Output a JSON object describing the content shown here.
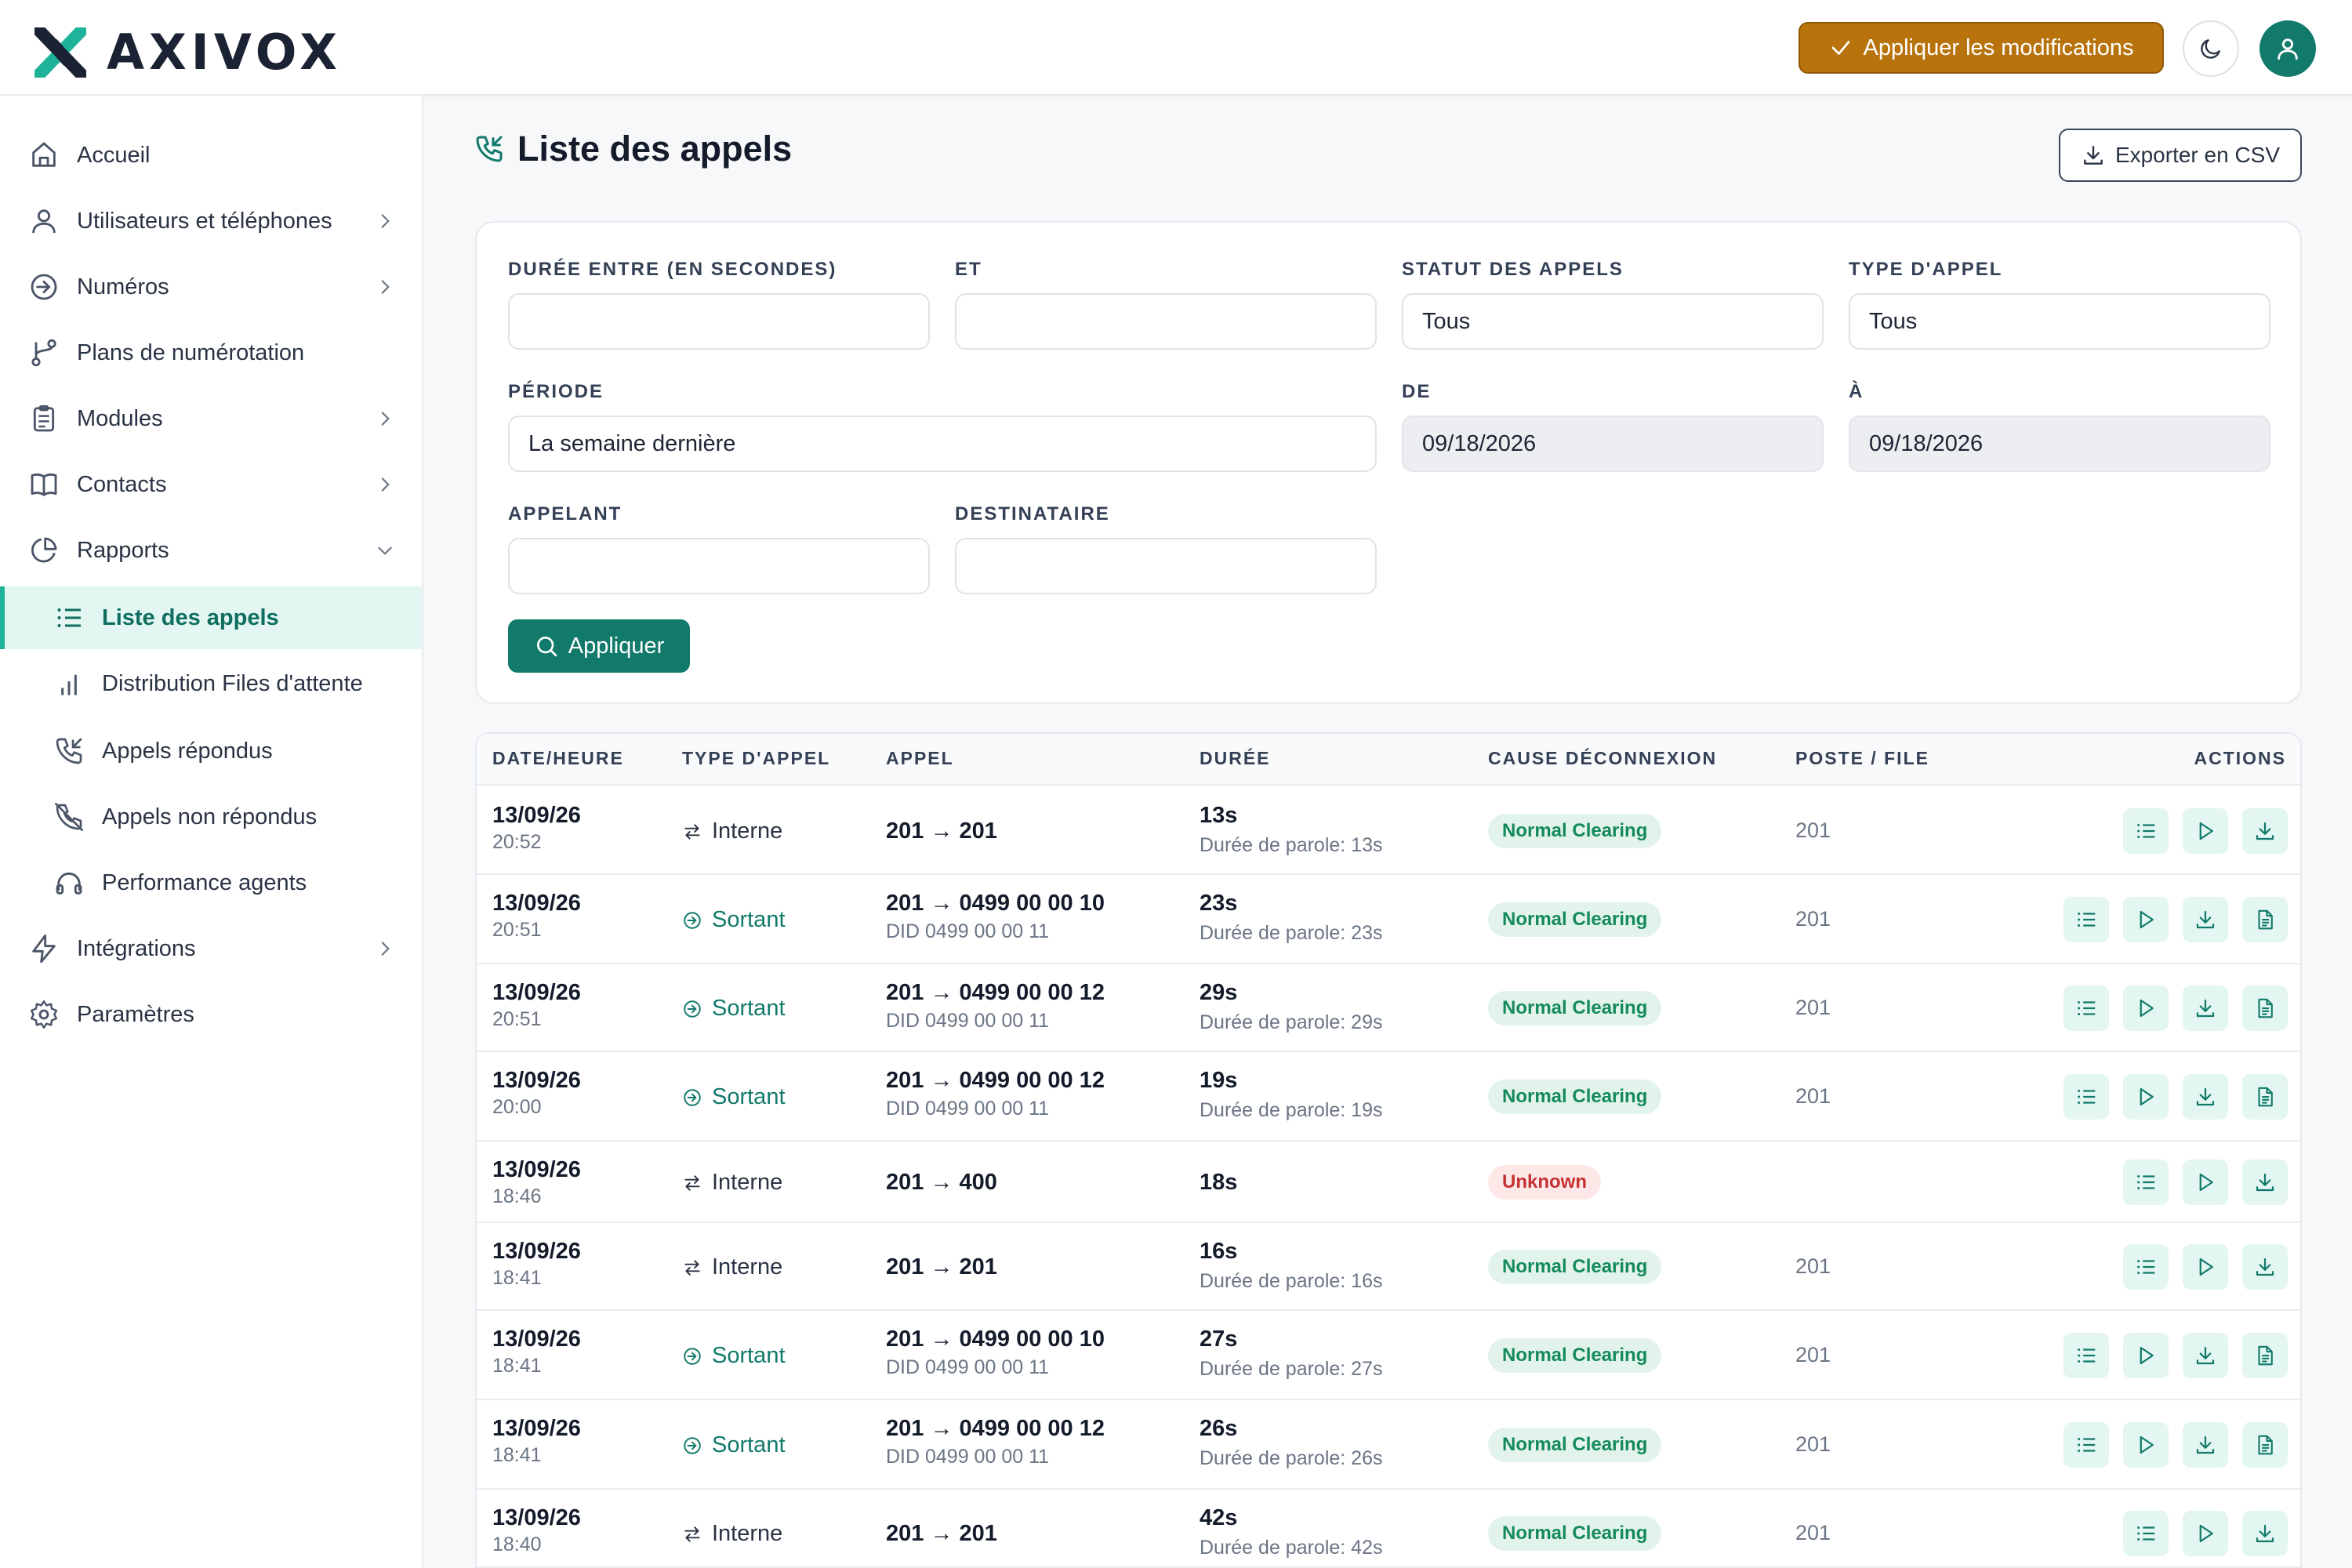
{
  "brand": {
    "name": "AXIVOX",
    "accent": "#117a6a",
    "highlight": "#1fb39a",
    "warning": "#b8730c"
  },
  "topbar": {
    "apply_label": "Appliquer les modifications",
    "theme_icon": "moon-icon",
    "avatar_icon": "user-icon"
  },
  "sidebar": {
    "items": [
      {
        "label": "Accueil",
        "icon": "home-icon"
      },
      {
        "label": "Utilisateurs et téléphones",
        "icon": "user-icon"
      },
      {
        "label": "Numéros",
        "icon": "arrow-circle-icon"
      },
      {
        "label": "Plans de numérotation",
        "icon": "git-branch-icon"
      },
      {
        "label": "Modules",
        "icon": "clipboard-icon"
      },
      {
        "label": "Contacts",
        "icon": "book-icon"
      },
      {
        "label": "Rapports",
        "icon": "pie-chart-icon"
      },
      {
        "label": "Liste des appels",
        "icon": "list-icon"
      },
      {
        "label": "Distribution Files d'attente",
        "icon": "bar-chart-icon"
      },
      {
        "label": "Appels répondus",
        "icon": "phone-incoming-icon"
      },
      {
        "label": "Appels non répondus",
        "icon": "phone-missed-icon"
      },
      {
        "label": "Performance agents",
        "icon": "headphones-icon"
      },
      {
        "label": "Intégrations",
        "icon": "zap-icon"
      },
      {
        "label": "Paramètres",
        "icon": "settings-icon"
      }
    ]
  },
  "page": {
    "title": "Liste des appels",
    "export_label": "Exporter en CSV"
  },
  "filters": {
    "duration_from_label": "DURÉE ENTRE (EN SECONDES)",
    "duration_from_value": "",
    "and_label": "ET",
    "and_value": "",
    "status_label": "STATUT DES APPELS",
    "status_value": "Tous",
    "type_label": "TYPE D'APPEL",
    "type_value": "Tous",
    "period_label": "PÉRIODE",
    "period_value": "La semaine dernière",
    "from_label": "DE",
    "from_value": "09/18/2026",
    "to_label": "À",
    "to_value": "09/18/2026",
    "caller_label": "APPELANT",
    "caller_value": "",
    "callee_label": "DESTINATAIRE",
    "callee_value": "",
    "apply_label": "Appliquer"
  },
  "table": {
    "headers": {
      "date": "DATE/HEURE",
      "type": "TYPE D'APPEL",
      "call": "APPEL",
      "duration": "DURÉE",
      "cause": "CAUSE DÉCONNEXION",
      "post": "POSTE / FILE",
      "actions": "ACTIONS"
    },
    "rows": [
      {
        "date": "13/09/26",
        "time": "20:52",
        "type": "Interne",
        "call": "201 → 201",
        "did": "",
        "duration": "13s",
        "talk": "Durée de parole: 13s",
        "cause": "Normal Clearing",
        "post": "201"
      },
      {
        "date": "13/09/26",
        "time": "20:51",
        "type": "Sortant",
        "call": "201 → 0499 00 00 10",
        "did": "DID 0499 00 00 11",
        "duration": "23s",
        "talk": "Durée de parole: 23s",
        "cause": "Normal Clearing",
        "post": "201"
      },
      {
        "date": "13/09/26",
        "time": "20:51",
        "type": "Sortant",
        "call": "201 → 0499 00 00 12",
        "did": "DID 0499 00 00 11",
        "duration": "29s",
        "talk": "Durée de parole: 29s",
        "cause": "Normal Clearing",
        "post": "201"
      },
      {
        "date": "13/09/26",
        "time": "20:00",
        "type": "Sortant",
        "call": "201 → 0499 00 00 12",
        "did": "DID 0499 00 00 11",
        "duration": "19s",
        "talk": "Durée de parole: 19s",
        "cause": "Normal Clearing",
        "post": "201"
      },
      {
        "date": "13/09/26",
        "time": "18:46",
        "type": "Interne",
        "call": "201 → 400",
        "did": "",
        "duration": "18s",
        "talk": "",
        "cause": "Unknown",
        "post": ""
      },
      {
        "date": "13/09/26",
        "time": "18:41",
        "type": "Interne",
        "call": "201 → 201",
        "did": "",
        "duration": "16s",
        "talk": "Durée de parole: 16s",
        "cause": "Normal Clearing",
        "post": "201"
      },
      {
        "date": "13/09/26",
        "time": "18:41",
        "type": "Sortant",
        "call": "201 → 0499 00 00 10",
        "did": "DID 0499 00 00 11",
        "duration": "27s",
        "talk": "Durée de parole: 27s",
        "cause": "Normal Clearing",
        "post": "201"
      },
      {
        "date": "13/09/26",
        "time": "18:41",
        "type": "Sortant",
        "call": "201 → 0499 00 00 12",
        "did": "DID 0499 00 00 11",
        "duration": "26s",
        "talk": "Durée de parole: 26s",
        "cause": "Normal Clearing",
        "post": "201"
      },
      {
        "date": "13/09/26",
        "time": "18:40",
        "type": "Interne",
        "call": "201 → 201",
        "did": "",
        "duration": "42s",
        "talk": "Durée de parole: 42s",
        "cause": "Normal Clearing",
        "post": "201"
      }
    ]
  }
}
